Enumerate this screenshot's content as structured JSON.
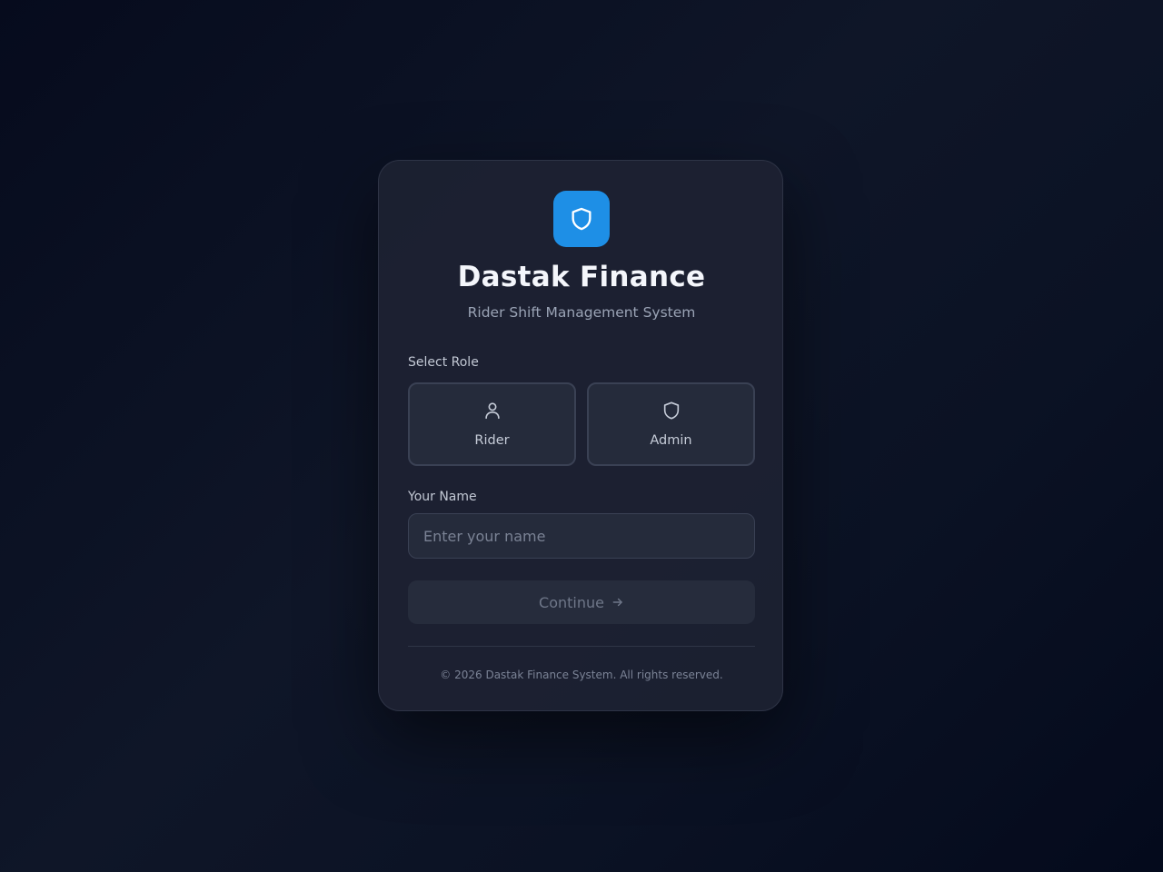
{
  "app": {
    "title": "Dastak Finance",
    "subtitle": "Rider Shift Management System",
    "logo_icon": "shield-icon",
    "accent_color": "#1e8fe6"
  },
  "role_select": {
    "label": "Select Role",
    "options": [
      {
        "label": "Rider",
        "icon": "user-icon"
      },
      {
        "label": "Admin",
        "icon": "shield-icon"
      }
    ]
  },
  "name_field": {
    "label": "Your Name",
    "placeholder": "Enter your name",
    "value": ""
  },
  "continue_button": {
    "label": "Continue",
    "icon": "arrow-right-icon"
  },
  "footer": {
    "text": "© 2026 Dastak Finance System. All rights reserved."
  }
}
